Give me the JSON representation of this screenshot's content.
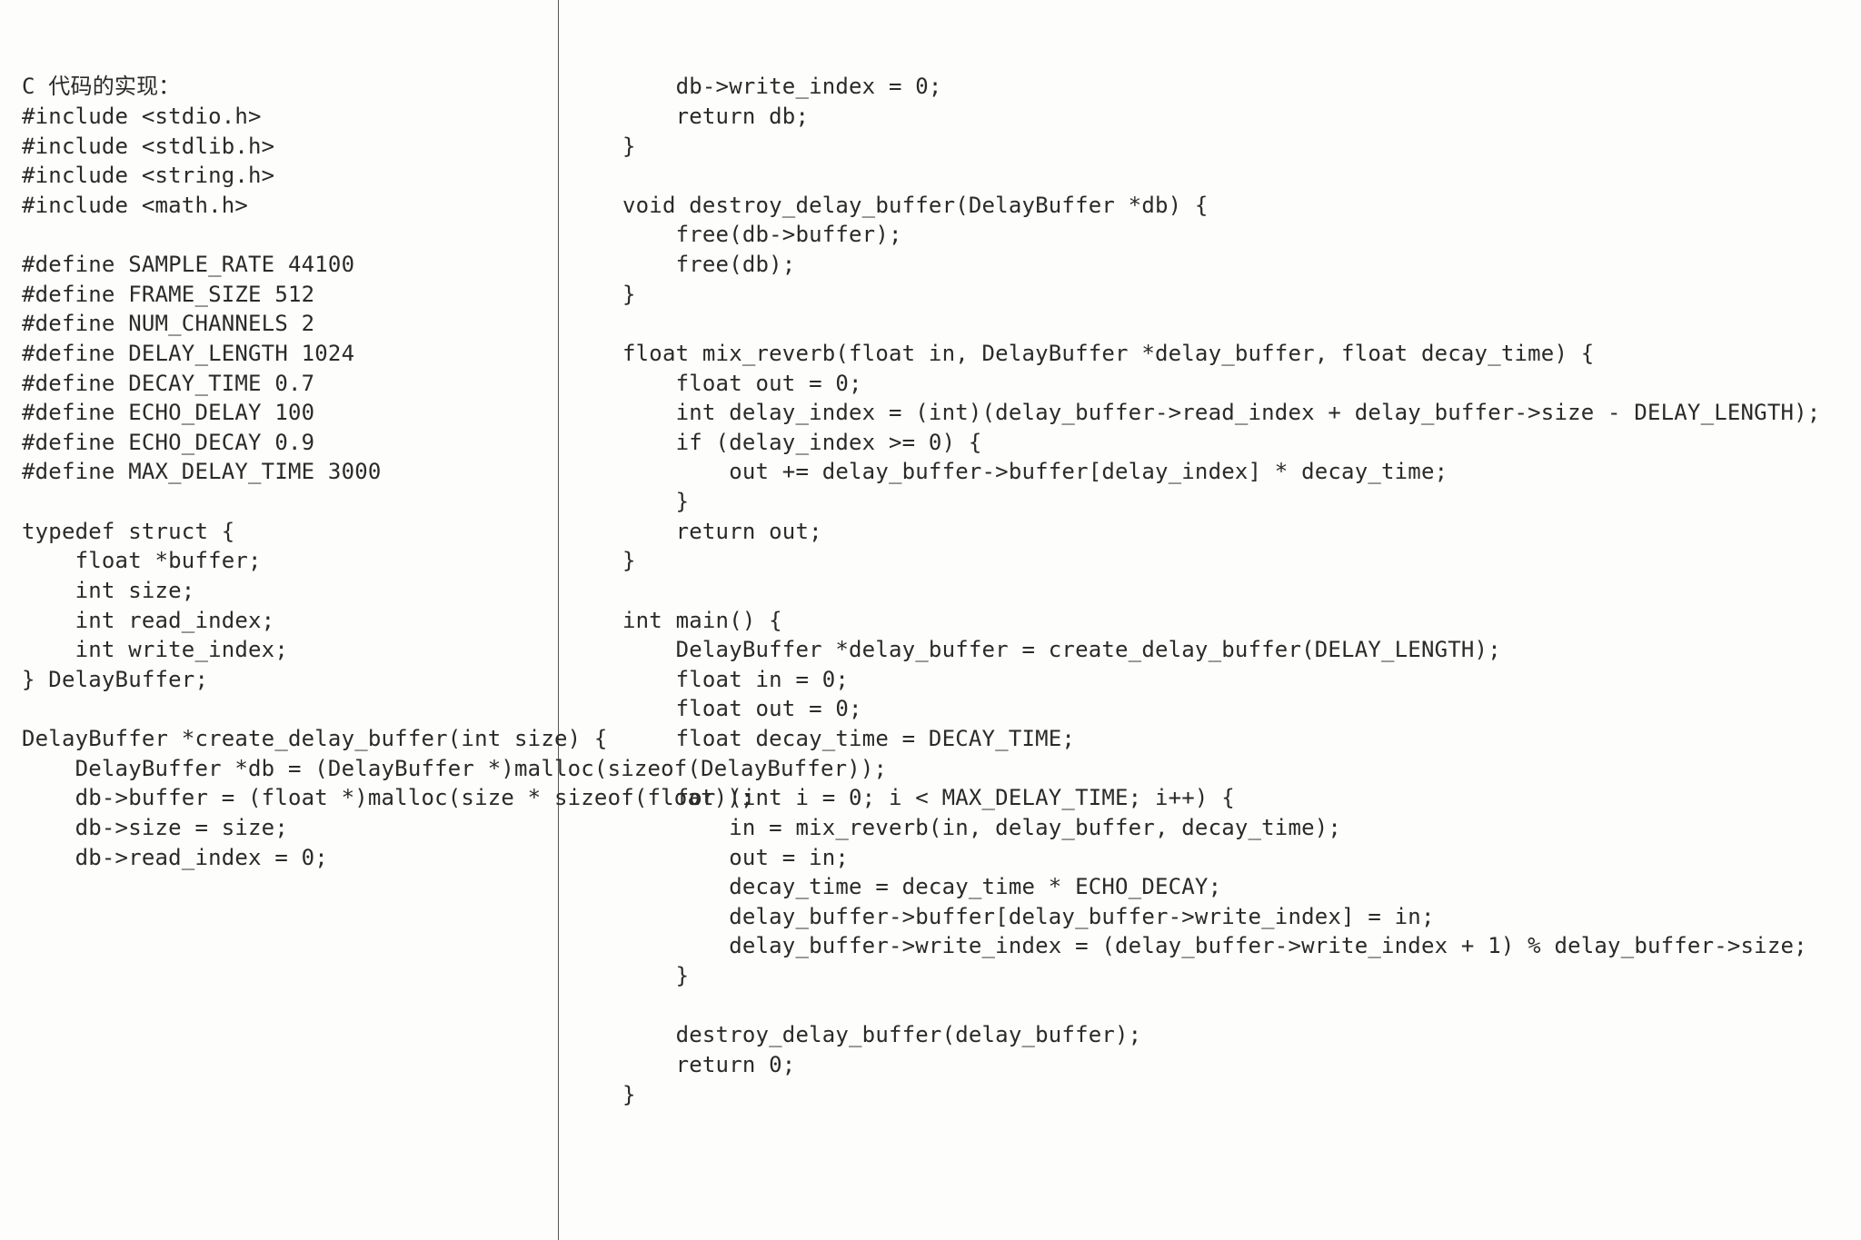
{
  "left_code": "C 代码的实现：\n#include <stdio.h>\n#include <stdlib.h>\n#include <string.h>\n#include <math.h>\n\n#define SAMPLE_RATE 44100\n#define FRAME_SIZE 512\n#define NUM_CHANNELS 2\n#define DELAY_LENGTH 1024\n#define DECAY_TIME 0.7\n#define ECHO_DELAY 100\n#define ECHO_DECAY 0.9\n#define MAX_DELAY_TIME 3000\n\ntypedef struct {\n    float *buffer;\n    int size;\n    int read_index;\n    int write_index;\n} DelayBuffer;\n\nDelayBuffer *create_delay_buffer(int size) {\n    DelayBuffer *db = (DelayBuffer *)malloc(sizeof(DelayBuffer));\n    db->buffer = (float *)malloc(size * sizeof(float));\n    db->size = size;\n    db->read_index = 0;",
  "right_code": "    db->write_index = 0;\n    return db;\n}\n\nvoid destroy_delay_buffer(DelayBuffer *db) {\n    free(db->buffer);\n    free(db);\n}\n\nfloat mix_reverb(float in, DelayBuffer *delay_buffer, float decay_time) {\n    float out = 0;\n    int delay_index = (int)(delay_buffer->read_index + delay_buffer->size - DELAY_LENGTH);\n    if (delay_index >= 0) {\n        out += delay_buffer->buffer[delay_index] * decay_time;\n    }\n    return out;\n}\n\nint main() {\n    DelayBuffer *delay_buffer = create_delay_buffer(DELAY_LENGTH);\n    float in = 0;\n    float out = 0;\n    float decay_time = DECAY_TIME;\n\n    for (int i = 0; i < MAX_DELAY_TIME; i++) {\n        in = mix_reverb(in, delay_buffer, decay_time);\n        out = in;\n        decay_time = decay_time * ECHO_DECAY;\n        delay_buffer->buffer[delay_buffer->write_index] = in;\n        delay_buffer->write_index = (delay_buffer->write_index + 1) % delay_buffer->size;\n    }\n\n    destroy_delay_buffer(delay_buffer);\n    return 0;\n}"
}
